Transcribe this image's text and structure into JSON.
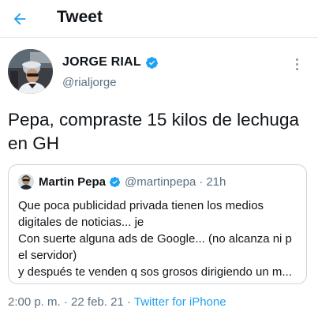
{
  "header": {
    "title": "Tweet",
    "back_icon": "arrow-left-icon"
  },
  "tweet": {
    "author_name": "JORGE RIAL",
    "author_handle": "@rialjorge",
    "text_line1": "Pepa, compraste 15 kilos de lechuga",
    "text_line2": "en GH",
    "timestamp_time": "2:00 p. m.",
    "separator": "·",
    "timestamp_date": "22 feb. 21",
    "source": "Twitter for iPhone"
  },
  "quoted_tweet": {
    "author_name": "Martin Pepa",
    "author_handle": "@martinpepa",
    "separator": "·",
    "time_ago": "21h",
    "lines": [
      "Que poca publicidad privada tienen los medios",
      "digitales de noticias... je",
      "Con suerte alguna ads de Google... (no alcanza ni p",
      "el servidor)",
      "y después te venden q sos grosos dirigiendo un m..."
    ]
  },
  "colors": {
    "accent": "#1da1f2",
    "secondary_text": "#5b7083",
    "border": "#ccd6dd"
  }
}
